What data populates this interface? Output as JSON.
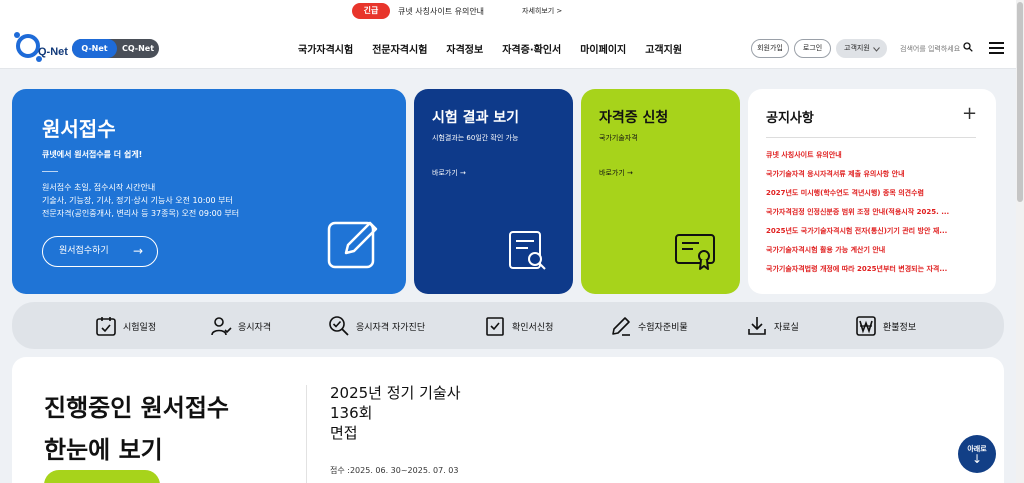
{
  "alert": {
    "badge": "긴급",
    "text": "큐넷 사칭사이트 유의안내",
    "more": "자세히보기 >"
  },
  "header": {
    "logo": "Q-Net",
    "switch": {
      "active": "Q-Net",
      "inactive": "CQ-Net"
    },
    "nav": [
      "국가자격시험",
      "전문자격시험",
      "자격정보",
      "자격증·확인서",
      "마이페이지",
      "고객지원"
    ],
    "join": "회원가입",
    "login": "로그인",
    "support": "고객지원",
    "search_placeholder": "검색어를 입력하세요"
  },
  "apply_card": {
    "title": "원서접수",
    "subtitle": "큐넷에서 원서접수를 더 쉽게!",
    "info": [
      "원서접수 초일, 접수시작 시간안내",
      "기술사, 기능장, 기사, 정기·상시 기능사 오전 10:00 부터",
      "전문자격(공인중개사, 변리사 등 37종목) 오전 09:00 부터"
    ],
    "button": "원서접수하기"
  },
  "result_card": {
    "title": "시험 결과 보기",
    "desc": "시험결과는 60일간 확인 가능",
    "link": "바로가기 →"
  },
  "cert_card": {
    "title": "자격증 신청",
    "desc": "국가기술자격",
    "link": "바로가기 →"
  },
  "notice": {
    "title": "공지사항",
    "plus": "+",
    "items": [
      "큐넷 사칭사이트 유의안내",
      "국가기술자격 응시자격서류 제출 유의사항 안내",
      "2027년도 미시행(학수연도 격년시행) 종목 의견수렴",
      "국가자격검정 인정신분증 범위 조정 안내(적용시작 2025. ...",
      "2025년도 국가기술자격시험 전자(통신)기기 관리 방안 재...",
      "국가기술자격시험 활용 가능 계산기 안내",
      "국가기술자격법령 개정에 따라 2025년부터 변경되는 자격..."
    ]
  },
  "quick_menu": [
    "시험일정",
    "응시자격",
    "응시자격 자가진단",
    "확인서신청",
    "수험자준비물",
    "자료실",
    "환불정보"
  ],
  "progress": {
    "title_line1": "진행중인 원서접수",
    "title_line2": "한눈에 보기",
    "exam_line1": "2025년 정기 기술사",
    "exam_line2": "136회",
    "exam_line3": "면접",
    "date": "접수 :2025. 06. 30~2025. 07. 03"
  },
  "down_button": {
    "label": "아래로",
    "arrow": "↓"
  },
  "colors": {
    "primary": "#1f74d6",
    "navy": "#0e3a8a",
    "lime": "#a7d31b",
    "alert": "#e8352b"
  }
}
